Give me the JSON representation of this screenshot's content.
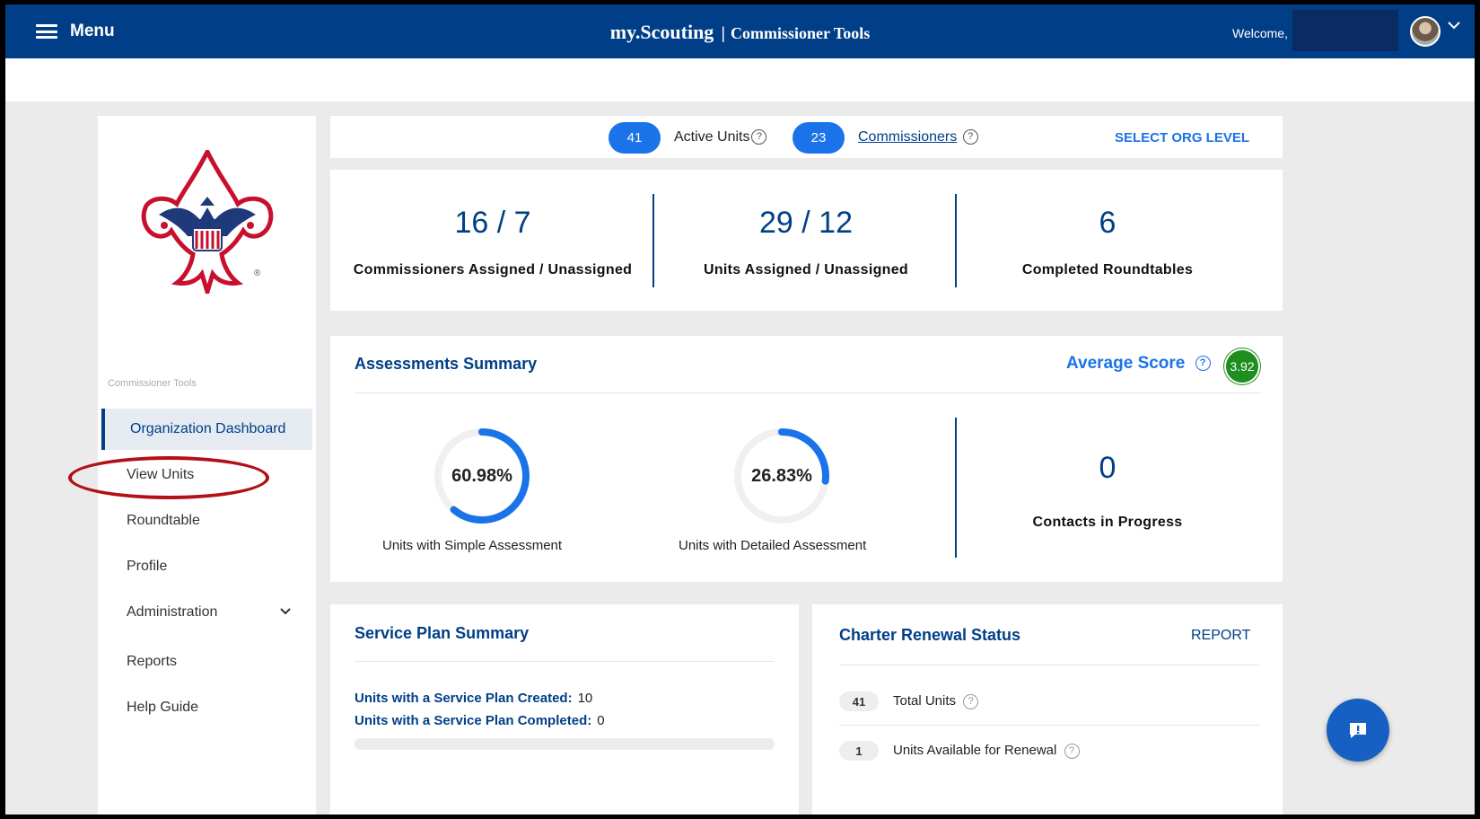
{
  "topbar": {
    "menu_label": "Menu",
    "brand": "my.Scouting",
    "separator": "|",
    "subtitle": "Commissioner Tools",
    "welcome": "Welcome,"
  },
  "sidebar": {
    "section_label": "Commissioner Tools",
    "items": [
      {
        "label": "Organization Dashboard"
      },
      {
        "label": "View Units"
      },
      {
        "label": "Roundtable"
      },
      {
        "label": "Profile"
      },
      {
        "label": "Administration"
      },
      {
        "label": "Reports"
      },
      {
        "label": "Help Guide"
      }
    ]
  },
  "stats_bar": {
    "active_units_count": "41",
    "active_units_label": "Active Units",
    "commissioners_count": "23",
    "commissioners_label": "Commissioners",
    "select_org_level": "SELECT ORG LEVEL",
    "help_glyph": "?"
  },
  "big_stats": [
    {
      "value": "16 / 7",
      "label": "Commissioners Assigned / Unassigned"
    },
    {
      "value": "29 / 12",
      "label": "Units Assigned / Unassigned"
    },
    {
      "value": "6",
      "label": "Completed Roundtables"
    }
  ],
  "assessments": {
    "title": "Assessments Summary",
    "average_label": "Average Score",
    "average_value": "3.92",
    "rings": [
      {
        "pct_text": "60.98%",
        "fraction": 0.6098,
        "label": "Units with Simple Assessment"
      },
      {
        "pct_text": "26.83%",
        "fraction": 0.2683,
        "label": "Units with Detailed Assessment"
      }
    ],
    "contacts_value": "0",
    "contacts_label": "Contacts in Progress"
  },
  "service_plan": {
    "title": "Service Plan Summary",
    "created_label": "Units with a Service Plan Created:",
    "created_value": "10",
    "completed_label": "Units with a Service Plan Completed:",
    "completed_value": "0"
  },
  "charter": {
    "title": "Charter Renewal Status",
    "report_label": "REPORT",
    "rows": [
      {
        "count": "41",
        "label": "Total Units"
      },
      {
        "count": "1",
        "label": "Units Available for Renewal"
      }
    ]
  },
  "colors": {
    "brand_blue": "#003f87",
    "accent_blue": "#1a73e8",
    "score_green": "#1e8e1e",
    "highlight_red": "#b30f17"
  },
  "icons": [
    "hamburger-icon",
    "chevron-down-icon",
    "help-icon",
    "bsa-logo",
    "chat-icon"
  ]
}
